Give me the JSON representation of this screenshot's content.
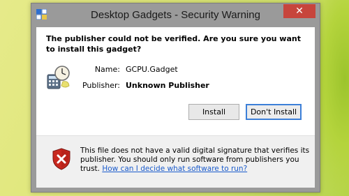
{
  "window": {
    "title": "Desktop Gadgets - Security Warning",
    "close_label": "✕"
  },
  "dialog": {
    "headline": "The publisher could not be verified. Are you sure you want to install this gadget?",
    "fields": {
      "name_label": "Name:",
      "name_value": "GCPU.Gadget",
      "publisher_label": "Publisher:",
      "publisher_value": "Unknown Publisher"
    },
    "buttons": {
      "install": "Install",
      "dont_install": "Don't Install"
    },
    "footer": {
      "text": "This file does not have a valid digital signature that verifies its publisher. You should only run software from publishers you trust.",
      "link": "How can I decide what software to run?"
    }
  },
  "icons": {
    "app": "gadgets-app-icon",
    "gadget": "calculator-clock-gadget-icon",
    "warning": "shield-warning-icon"
  },
  "colors": {
    "close_button": "#c7453c",
    "default_button_border": "#3c7fd8",
    "link": "#1a5bcc",
    "shield_red": "#c8281e"
  }
}
